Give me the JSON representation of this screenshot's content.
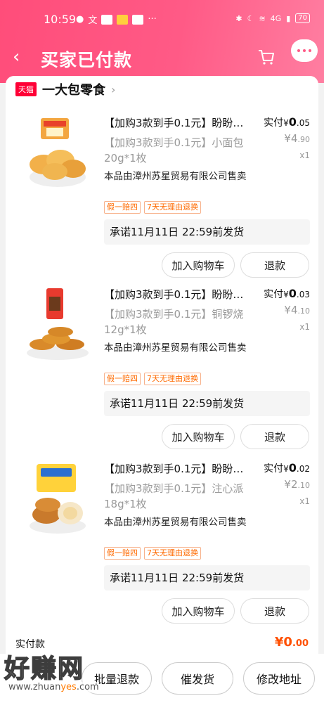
{
  "status_bar": {
    "time": "10:59",
    "left_icons": [
      "wechat-icon",
      "text-icon",
      "taobao-icon",
      "redpacket-icon",
      "mail-icon"
    ],
    "more": "···",
    "signal": "4G",
    "battery": "70"
  },
  "header": {
    "title": "买家已付款",
    "back_glyph": "‹"
  },
  "store": {
    "badge": "天猫",
    "name": "一大包零食",
    "arrow": "›"
  },
  "items": [
    {
      "name": "【加购3款到手0.1元】盼盼…",
      "spec": "【加购3款到手0.1元】小面包20g*1枚",
      "seller": "本品由漳州苏星贸易有限公司售卖",
      "tags": [
        "假一赔四",
        "7天无理由退换"
      ],
      "price_label": "实付",
      "price_symbol": "¥",
      "price_int": "0",
      "price_dec": ".05",
      "orig_int": "¥4",
      "orig_dec": ".90",
      "qty": "x1",
      "promise": "承诺11月11日 22:59前发货",
      "cart_btn": "加入购物车",
      "refund_btn": "退款"
    },
    {
      "name": "【加购3款到手0.1元】盼盼…",
      "spec": "【加购3款到手0.1元】铜锣烧12g*1枚",
      "seller": "本品由漳州苏星贸易有限公司售卖",
      "tags": [
        "假一赔四",
        "7天无理由退换"
      ],
      "price_label": "实付",
      "price_symbol": "¥",
      "price_int": "0",
      "price_dec": ".03",
      "orig_int": "¥4",
      "orig_dec": ".10",
      "qty": "x1",
      "promise": "承诺11月11日 22:59前发货",
      "cart_btn": "加入购物车",
      "refund_btn": "退款"
    },
    {
      "name": "【加购3款到手0.1元】盼盼…",
      "spec": "【加购3款到手0.1元】注心派18g*1枚",
      "seller": "本品由漳州苏星贸易有限公司售卖",
      "tags": [
        "假一赔四",
        "7天无理由退换"
      ],
      "price_label": "实付",
      "price_symbol": "¥",
      "price_int": "0",
      "price_dec": ".02",
      "orig_int": "¥2",
      "orig_dec": ".10",
      "qty": "x1",
      "promise": "承诺11月11日 22:59前发货",
      "cart_btn": "加入购物车",
      "refund_btn": "退款"
    }
  ],
  "summary": {
    "label": "实付款",
    "amount_int": "¥0",
    "amount_dec": ".00"
  },
  "bottom_bar": {
    "batch_refund": "批量退款",
    "urge_ship": "催发货",
    "change_address": "修改地址"
  },
  "watermark": {
    "big": "好赚网",
    "small_a": "www.zhuan",
    "small_b": "yes",
    "small_c": ".com"
  },
  "colors": {
    "header": "#ff5a86",
    "price": "#ff5000",
    "tag": "#ff6a00",
    "tmall": "#ff0036"
  }
}
